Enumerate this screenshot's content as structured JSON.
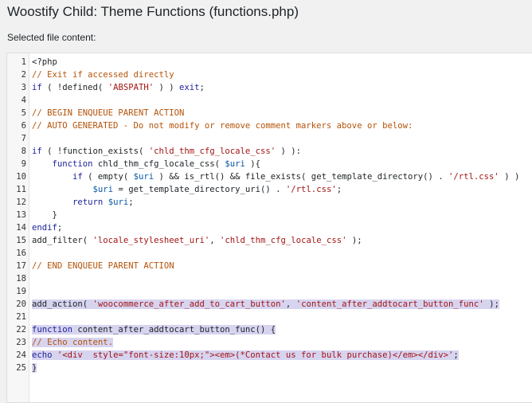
{
  "page": {
    "title": "Woostify Child: Theme Functions (functions.php)",
    "file_content_label": "Selected file content:"
  },
  "colors": {
    "background": "#f1f1f1",
    "editor_background": "#ffffff",
    "gutter_background": "#f7f7f7",
    "selection_highlight": "#d7d4f0",
    "comment": "#b45309",
    "keyword": "#1d2399",
    "string": "#a31515",
    "variable": "#0b5aa6"
  },
  "editor": {
    "lines": [
      {
        "number": "1",
        "text": "<?php",
        "highlighted": false
      },
      {
        "number": "2",
        "text": "// Exit if accessed directly",
        "highlighted": false
      },
      {
        "number": "3",
        "text": "if ( !defined( 'ABSPATH' ) ) exit;",
        "highlighted": false
      },
      {
        "number": "4",
        "text": "",
        "highlighted": false
      },
      {
        "number": "5",
        "text": "// BEGIN ENQUEUE PARENT ACTION",
        "highlighted": false
      },
      {
        "number": "6",
        "text": "// AUTO GENERATED - Do not modify or remove comment markers above or below:",
        "highlighted": false
      },
      {
        "number": "7",
        "text": "",
        "highlighted": false
      },
      {
        "number": "8",
        "text": "if ( !function_exists( 'chld_thm_cfg_locale_css' ) ):",
        "highlighted": false
      },
      {
        "number": "9",
        "text": "    function chld_thm_cfg_locale_css( $uri ){",
        "highlighted": false
      },
      {
        "number": "10",
        "text": "        if ( empty( $uri ) && is_rtl() && file_exists( get_template_directory() . '/rtl.css' ) )",
        "highlighted": false
      },
      {
        "number": "11",
        "text": "            $uri = get_template_directory_uri() . '/rtl.css';",
        "highlighted": false
      },
      {
        "number": "12",
        "text": "        return $uri;",
        "highlighted": false
      },
      {
        "number": "13",
        "text": "    }",
        "highlighted": false
      },
      {
        "number": "14",
        "text": "endif;",
        "highlighted": false
      },
      {
        "number": "15",
        "text": "add_filter( 'locale_stylesheet_uri', 'chld_thm_cfg_locale_css' );",
        "highlighted": false
      },
      {
        "number": "16",
        "text": "",
        "highlighted": false
      },
      {
        "number": "17",
        "text": "// END ENQUEUE PARENT ACTION",
        "highlighted": false
      },
      {
        "number": "18",
        "text": "",
        "highlighted": false
      },
      {
        "number": "19",
        "text": "",
        "highlighted": false
      },
      {
        "number": "20",
        "text": "add_action( 'woocommerce_after_add_to_cart_button', 'content_after_addtocart_button_func' );",
        "highlighted": true
      },
      {
        "number": "21",
        "text": "",
        "highlighted": true
      },
      {
        "number": "22",
        "text": "function content_after_addtocart_button_func() {",
        "highlighted": true
      },
      {
        "number": "23",
        "text": "// Echo content.",
        "highlighted": true
      },
      {
        "number": "24",
        "text": "echo '<div  style=\"font-size:10px;\"><em>(*Contact us for bulk purchase)</em></div>';",
        "highlighted": true
      },
      {
        "number": "25",
        "text": "}",
        "highlighted": true
      }
    ]
  }
}
